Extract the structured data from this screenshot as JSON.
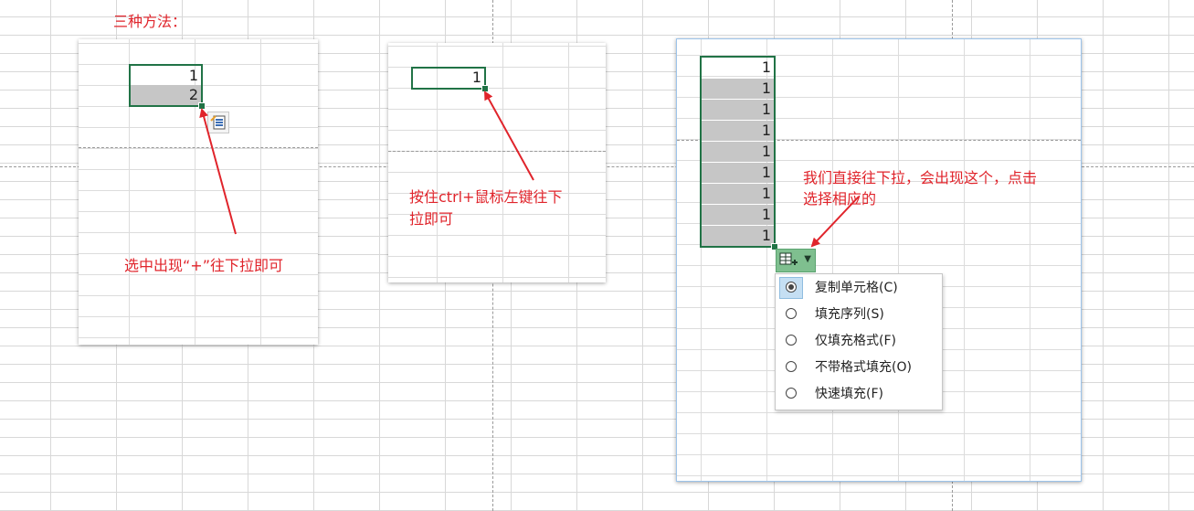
{
  "title": "三种方法：",
  "panel1": {
    "cells": [
      "1",
      "2"
    ],
    "note": "选中出现“+”往下拉即可"
  },
  "panel2": {
    "cell": "1",
    "note_line1": "按住ctrl+鼠标左键往下",
    "note_line2": "拉即可"
  },
  "panel3": {
    "cells": [
      "1",
      "1",
      "1",
      "1",
      "1",
      "1",
      "1",
      "1",
      "1"
    ],
    "note_line1": "我们直接往下拉，会出现这个，点击",
    "note_line2": "选择相应的"
  },
  "autofill_menu": {
    "items": [
      {
        "label": "复制单元格(C)",
        "selected": true
      },
      {
        "label": "填充序列(S)",
        "selected": false
      },
      {
        "label": "仅填充格式(F)",
        "selected": false
      },
      {
        "label": "不带格式填充(O)",
        "selected": false
      },
      {
        "label": "快速填充(F)",
        "selected": false
      }
    ]
  },
  "colors": {
    "accent": "#217346",
    "annotation": "#e0242b",
    "selection": "#c6c6c6"
  },
  "icons": [
    "autofill-options-icon",
    "chevron-down-icon",
    "arrow-icon"
  ]
}
